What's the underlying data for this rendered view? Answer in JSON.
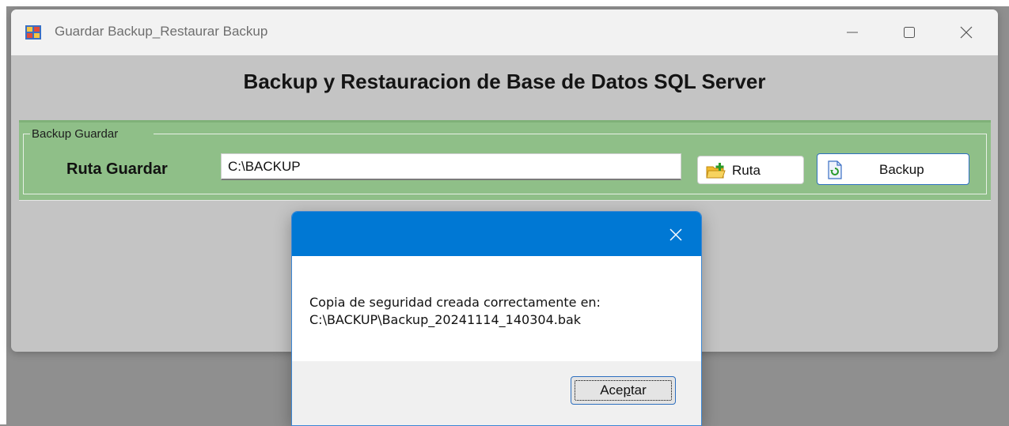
{
  "window": {
    "title": "Guardar Backup_Restaurar Backup",
    "heading": "Backup y Restauracion de Base de Datos SQL Server"
  },
  "backup_group": {
    "legend": "Backup Guardar",
    "path_label": "Ruta Guardar",
    "path_value": "C:\\BACKUP",
    "ruta_button": "Ruta",
    "backup_button": "Backup"
  },
  "dialog": {
    "message_line1": "Copia de seguridad creada correctamente en:",
    "message_line2": "C:\\BACKUP\\Backup_20241114_140304.bak",
    "ok_button": {
      "before": "Ace",
      "accel": "p",
      "after": "tar"
    }
  },
  "colors": {
    "dialog_titlebar": "#0078d4",
    "groupbox_background": "#8fbf88",
    "focus_border": "#2d6fbf"
  },
  "icons": [
    "app-icon",
    "minimize-icon",
    "maximize-icon",
    "close-icon",
    "folder-add-icon",
    "backup-document-icon",
    "dialog-close-icon"
  ]
}
